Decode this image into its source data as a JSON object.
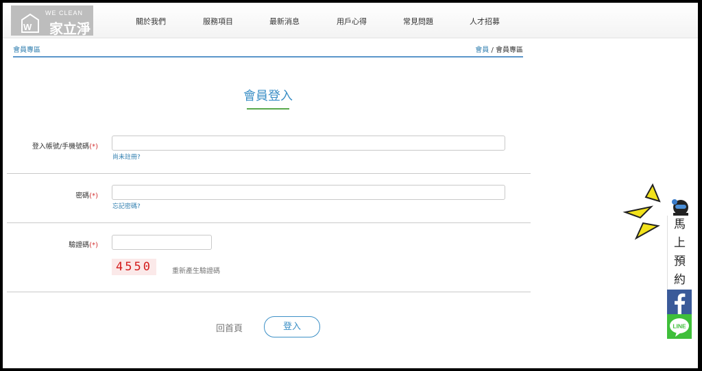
{
  "header": {
    "logo_sub": "WE CLEAN",
    "logo_main": "家立淨",
    "nav": [
      "關於我們",
      "服務項目",
      "最新消息",
      "用戶心得",
      "常見問題",
      "人才招募"
    ]
  },
  "breadcrumb": {
    "section": "會員專區",
    "home": "會員",
    "separator": "/",
    "current": "會員專區"
  },
  "page_title": "會員登入",
  "form": {
    "account_label": "登入帳號/手機號碼",
    "required_mark": "(*)",
    "account_value": "",
    "register_link": "尚未註冊?",
    "password_label": "密碼",
    "password_value": "",
    "forgot_link": "忘記密碼?",
    "captcha_label": "驗證碼",
    "captcha_value": "",
    "captcha_code": "4550",
    "refresh_link": "重新產生驗證碼"
  },
  "actions": {
    "home_label": "回首頁",
    "login_label": "登入"
  },
  "side_widget": {
    "book_chars": [
      "馬",
      "上",
      "預",
      "約"
    ],
    "facebook_icon": "facebook-icon",
    "line_label": "LINE"
  },
  "colors": {
    "accent": "#3b8fc6",
    "underline": "#57a84a",
    "required": "#d23232",
    "facebook": "#3a5a99",
    "line": "#3fbf3a"
  }
}
